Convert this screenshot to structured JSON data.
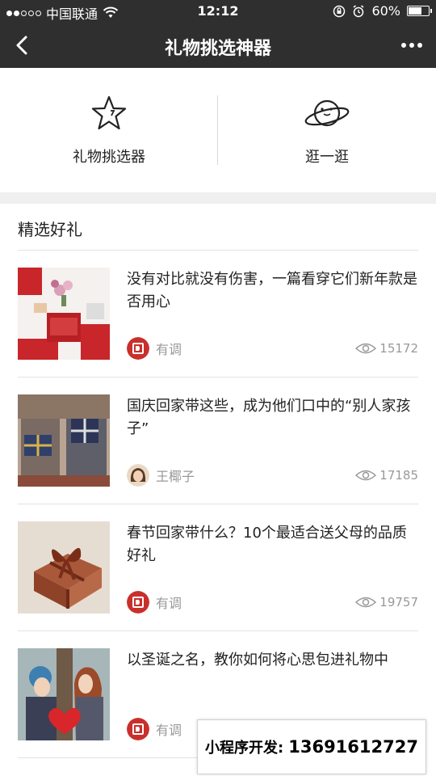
{
  "status_bar": {
    "carrier": "中国联通",
    "time": "12:12",
    "battery": "60%",
    "battery_level": 0.6
  },
  "nav": {
    "title": "礼物挑选神器",
    "back_icon": "chevron-left-icon",
    "more_icon": "more-dots-icon"
  },
  "options": [
    {
      "label": "礼物挑选器",
      "icon": "star-icon"
    },
    {
      "label": "逛一逛",
      "icon": "planet-icon"
    }
  ],
  "section": {
    "title": "精选好礼"
  },
  "articles": [
    {
      "title": "没有对比就没有伤害，一篇看穿它们新年款是否用心",
      "author": "有调",
      "views": "15172",
      "thumb": "gift-boxes-red"
    },
    {
      "title": "国庆回家带这些，成为他们口中的“别人家孩子”",
      "author": "王椰子",
      "views": "17185",
      "thumb": "gifts-behind-back"
    },
    {
      "title": "春节回家带什么？10个最适合送父母的品质好礼",
      "author": "有调",
      "views": "19757",
      "thumb": "wrapped-gift-box"
    },
    {
      "title": "以圣诞之名，教你如何将心思包进礼物中",
      "author": "有调",
      "views": "",
      "thumb": "couple-heart"
    }
  ],
  "dev_banner": {
    "label": "小程序开发:",
    "phone": "13691612727"
  }
}
